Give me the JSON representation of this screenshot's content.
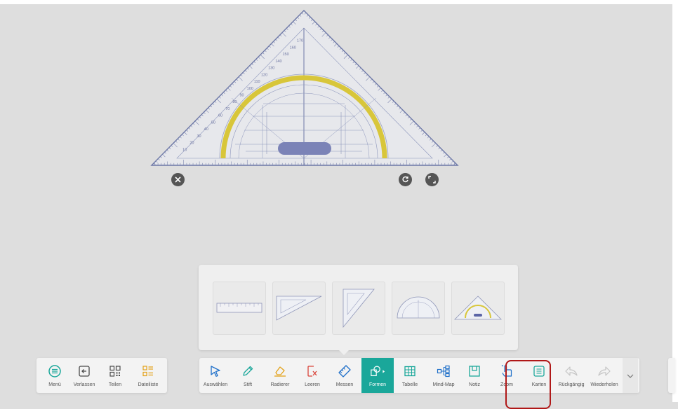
{
  "colors": {
    "accent": "#1aa79a",
    "highlight": "#b01818",
    "canvas": "#dedede",
    "protractor_arc": "#d8c63a"
  },
  "set_square": {
    "scale_labels": [
      "10",
      "20",
      "30",
      "40",
      "50",
      "60",
      "70",
      "80",
      "90",
      "100",
      "110",
      "120",
      "130",
      "140",
      "150",
      "160",
      "170"
    ],
    "controls": {
      "close_icon": "close-icon",
      "rotate_icon": "rotate-icon",
      "resize_icon": "resize-icon"
    }
  },
  "shapes_popup": {
    "tiles": [
      {
        "name": "ruler",
        "icon": "ruler-icon"
      },
      {
        "name": "set-square-45",
        "icon": "set-square-45-icon"
      },
      {
        "name": "set-square-60",
        "icon": "set-square-60-icon"
      },
      {
        "name": "protractor",
        "icon": "protractor-icon"
      },
      {
        "name": "geodreieck",
        "icon": "geodreieck-icon"
      }
    ]
  },
  "toolbar_left": {
    "items": [
      {
        "label": "Menü",
        "icon": "menu-icon"
      },
      {
        "label": "Verlassen",
        "icon": "exit-icon"
      },
      {
        "label": "Teilen",
        "icon": "qr-share-icon"
      },
      {
        "label": "Dateiliste",
        "icon": "file-list-icon"
      }
    ]
  },
  "toolbar_main": {
    "items": [
      {
        "label": "Auswählen",
        "icon": "select-cursor-icon"
      },
      {
        "label": "Stift",
        "icon": "pen-icon"
      },
      {
        "label": "Radierer",
        "icon": "eraser-icon"
      },
      {
        "label": "Leeren",
        "icon": "clear-icon"
      },
      {
        "label": "Messen",
        "icon": "ruler-icon"
      },
      {
        "label": "Formen",
        "icon": "shapes-icon",
        "active": true
      },
      {
        "label": "Tabelle",
        "icon": "table-icon"
      },
      {
        "label": "Mind-Map",
        "icon": "mind-map-icon"
      },
      {
        "label": "Notiz",
        "icon": "note-icon"
      },
      {
        "label": "Zoom",
        "icon": "zoom-hand-icon"
      },
      {
        "label": "Karten",
        "icon": "cards-icon"
      },
      {
        "label": "Rückgängig",
        "icon": "undo-icon"
      },
      {
        "label": "Wiederholen",
        "icon": "redo-icon"
      }
    ],
    "expand_icon": "chevron-down-icon"
  }
}
